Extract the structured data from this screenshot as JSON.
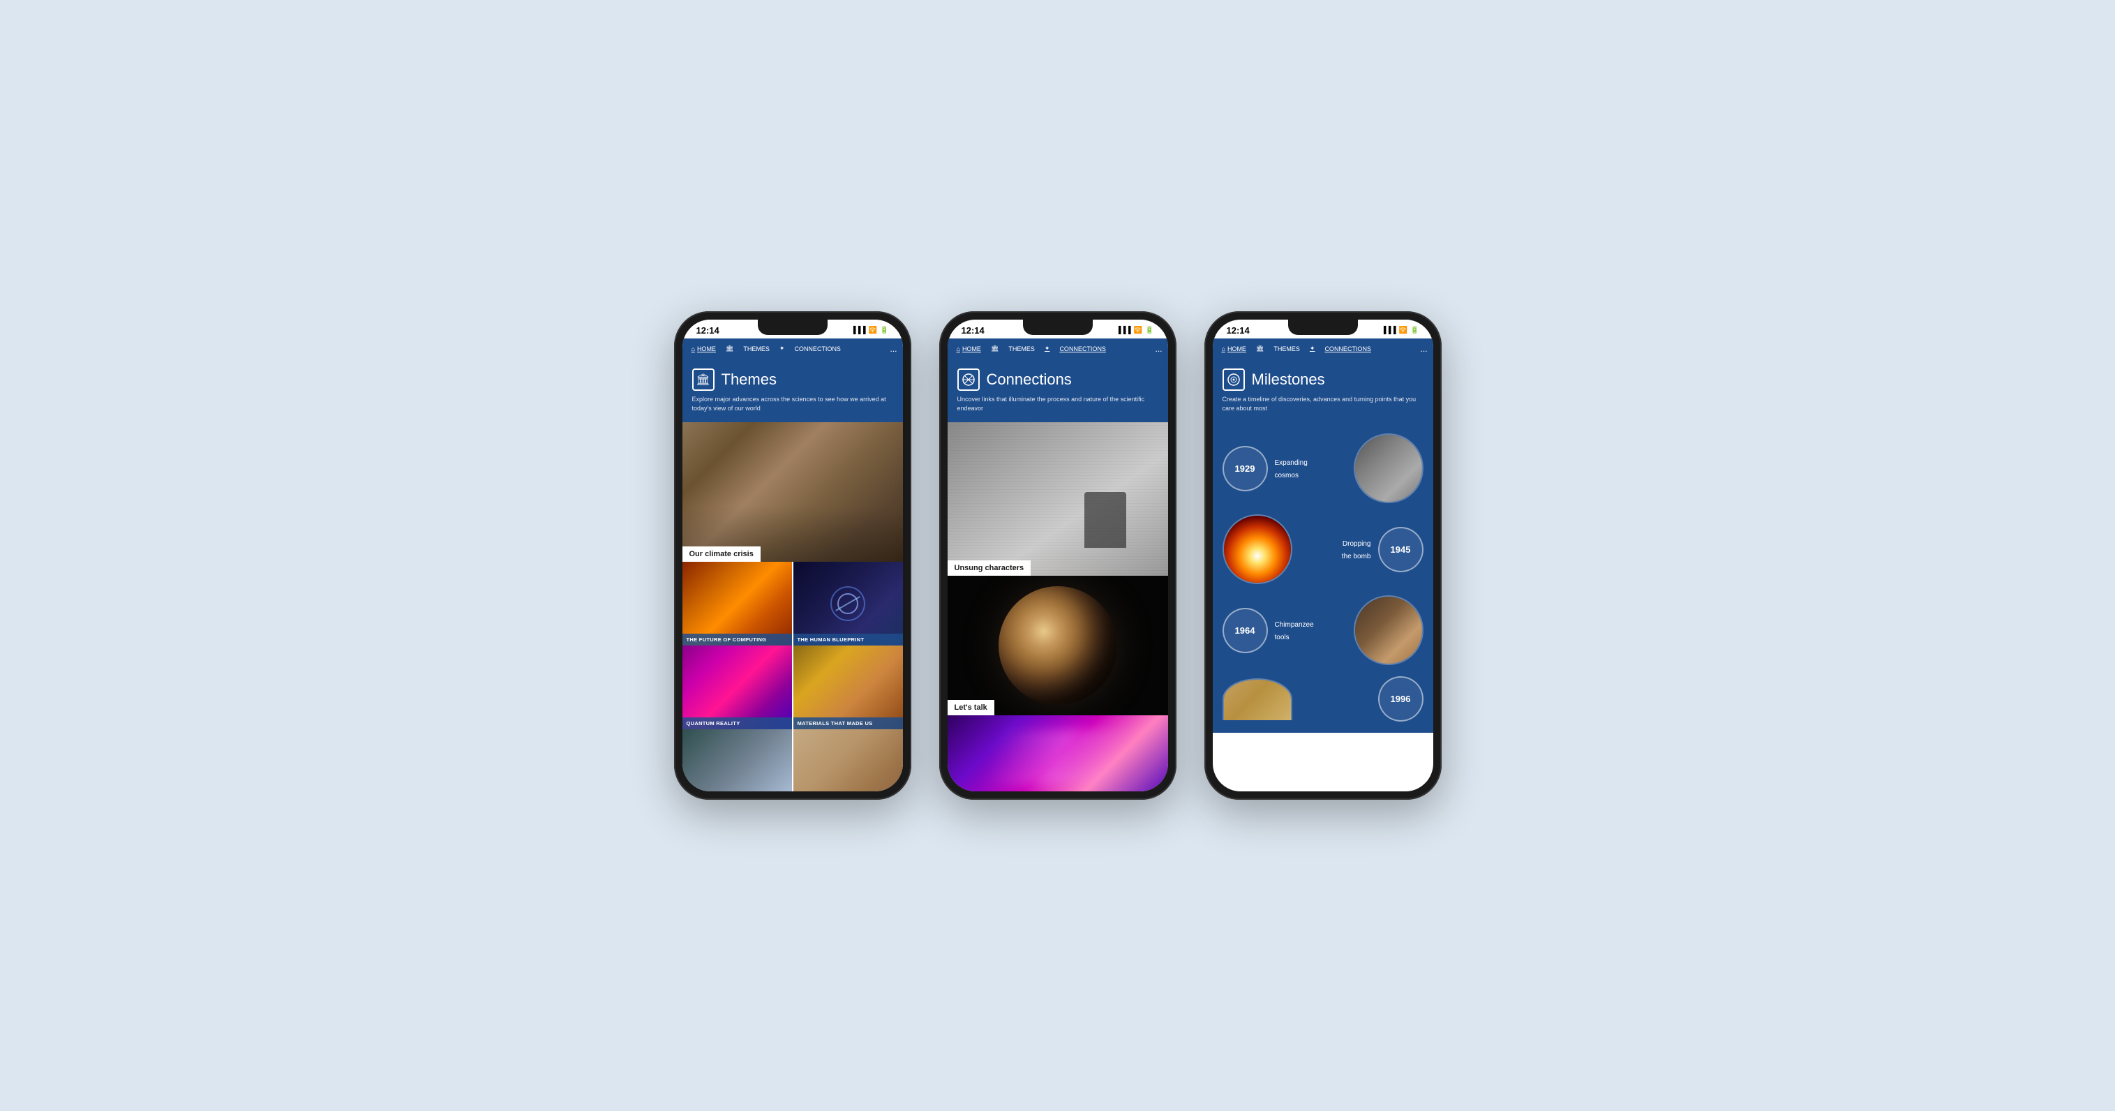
{
  "phones": [
    {
      "id": "phone-themes",
      "status_time": "12:14",
      "nav": {
        "items": [
          {
            "label": "HOME",
            "active": true,
            "icon": "🏠"
          },
          {
            "label": "THEMES",
            "active": false,
            "icon": "🏛"
          },
          {
            "label": "CONNECTIONS",
            "active": false,
            "icon": "✦"
          },
          {
            "label": "...",
            "active": false,
            "icon": ""
          }
        ]
      },
      "hero": {
        "title": "Themes",
        "icon": "🏛",
        "subtitle": "Explore major advances across the sciences to see how we arrived at today's view of our world"
      },
      "images": [
        {
          "label": "Our climate crisis",
          "type": "full",
          "style": "climate"
        },
        {
          "label": "THE FUTURE OF COMPUTING",
          "type": "half",
          "style": "circuit"
        },
        {
          "label": "THE HUMAN BLUEPRINT",
          "type": "half",
          "style": "blueprint"
        },
        {
          "label": "QUANTUM REALITY",
          "type": "half",
          "style": "quantum"
        },
        {
          "label": "MATERIALS THAT MADE US",
          "type": "half",
          "style": "materials"
        },
        {
          "label": "",
          "type": "half",
          "style": "bottom-left"
        },
        {
          "label": "",
          "type": "half",
          "style": "bottom-right"
        }
      ]
    },
    {
      "id": "phone-connections",
      "status_time": "12:14",
      "nav": {
        "items": [
          {
            "label": "HOME",
            "active": true,
            "icon": "🏠"
          },
          {
            "label": "THEMES",
            "active": false,
            "icon": "🏛"
          },
          {
            "label": "CONNECTIONS",
            "active": true,
            "icon": "✦"
          },
          {
            "label": "...",
            "active": false,
            "icon": ""
          }
        ]
      },
      "hero": {
        "title": "Connections",
        "icon": "✦",
        "subtitle": "Uncover links that illuminate the process and nature of the scientific endeavor"
      },
      "sections": [
        {
          "label": "Unsung characters",
          "type": "full"
        },
        {
          "label": "Let's talk",
          "type": "full"
        },
        {
          "label": "",
          "type": "bottom"
        }
      ]
    },
    {
      "id": "phone-milestones",
      "status_time": "12:14",
      "nav": {
        "items": [
          {
            "label": "HOME",
            "active": true,
            "icon": "🏠"
          },
          {
            "label": "THEMES",
            "active": false,
            "icon": "🏛"
          },
          {
            "label": "CONNECTIONS",
            "active": true,
            "icon": "✦"
          },
          {
            "label": "...",
            "active": false,
            "icon": ""
          }
        ]
      },
      "hero": {
        "title": "Milestones",
        "icon": "⊙",
        "subtitle": "Create a timeline of discoveries, advances and turning points that you care about most"
      },
      "milestones": [
        {
          "year": "1929",
          "label": "Expanding\ncosmos",
          "side": "right",
          "img_style": "cosmos"
        },
        {
          "year": "1945",
          "label": "Dropping\nthe bomb",
          "side": "left",
          "img_style": "bomb"
        },
        {
          "year": "1964",
          "label": "Chimpanzee\ntools",
          "side": "right",
          "img_style": "chimp"
        },
        {
          "year": "1996",
          "label": "",
          "side": "left",
          "img_style": "cosmos"
        }
      ]
    }
  ]
}
